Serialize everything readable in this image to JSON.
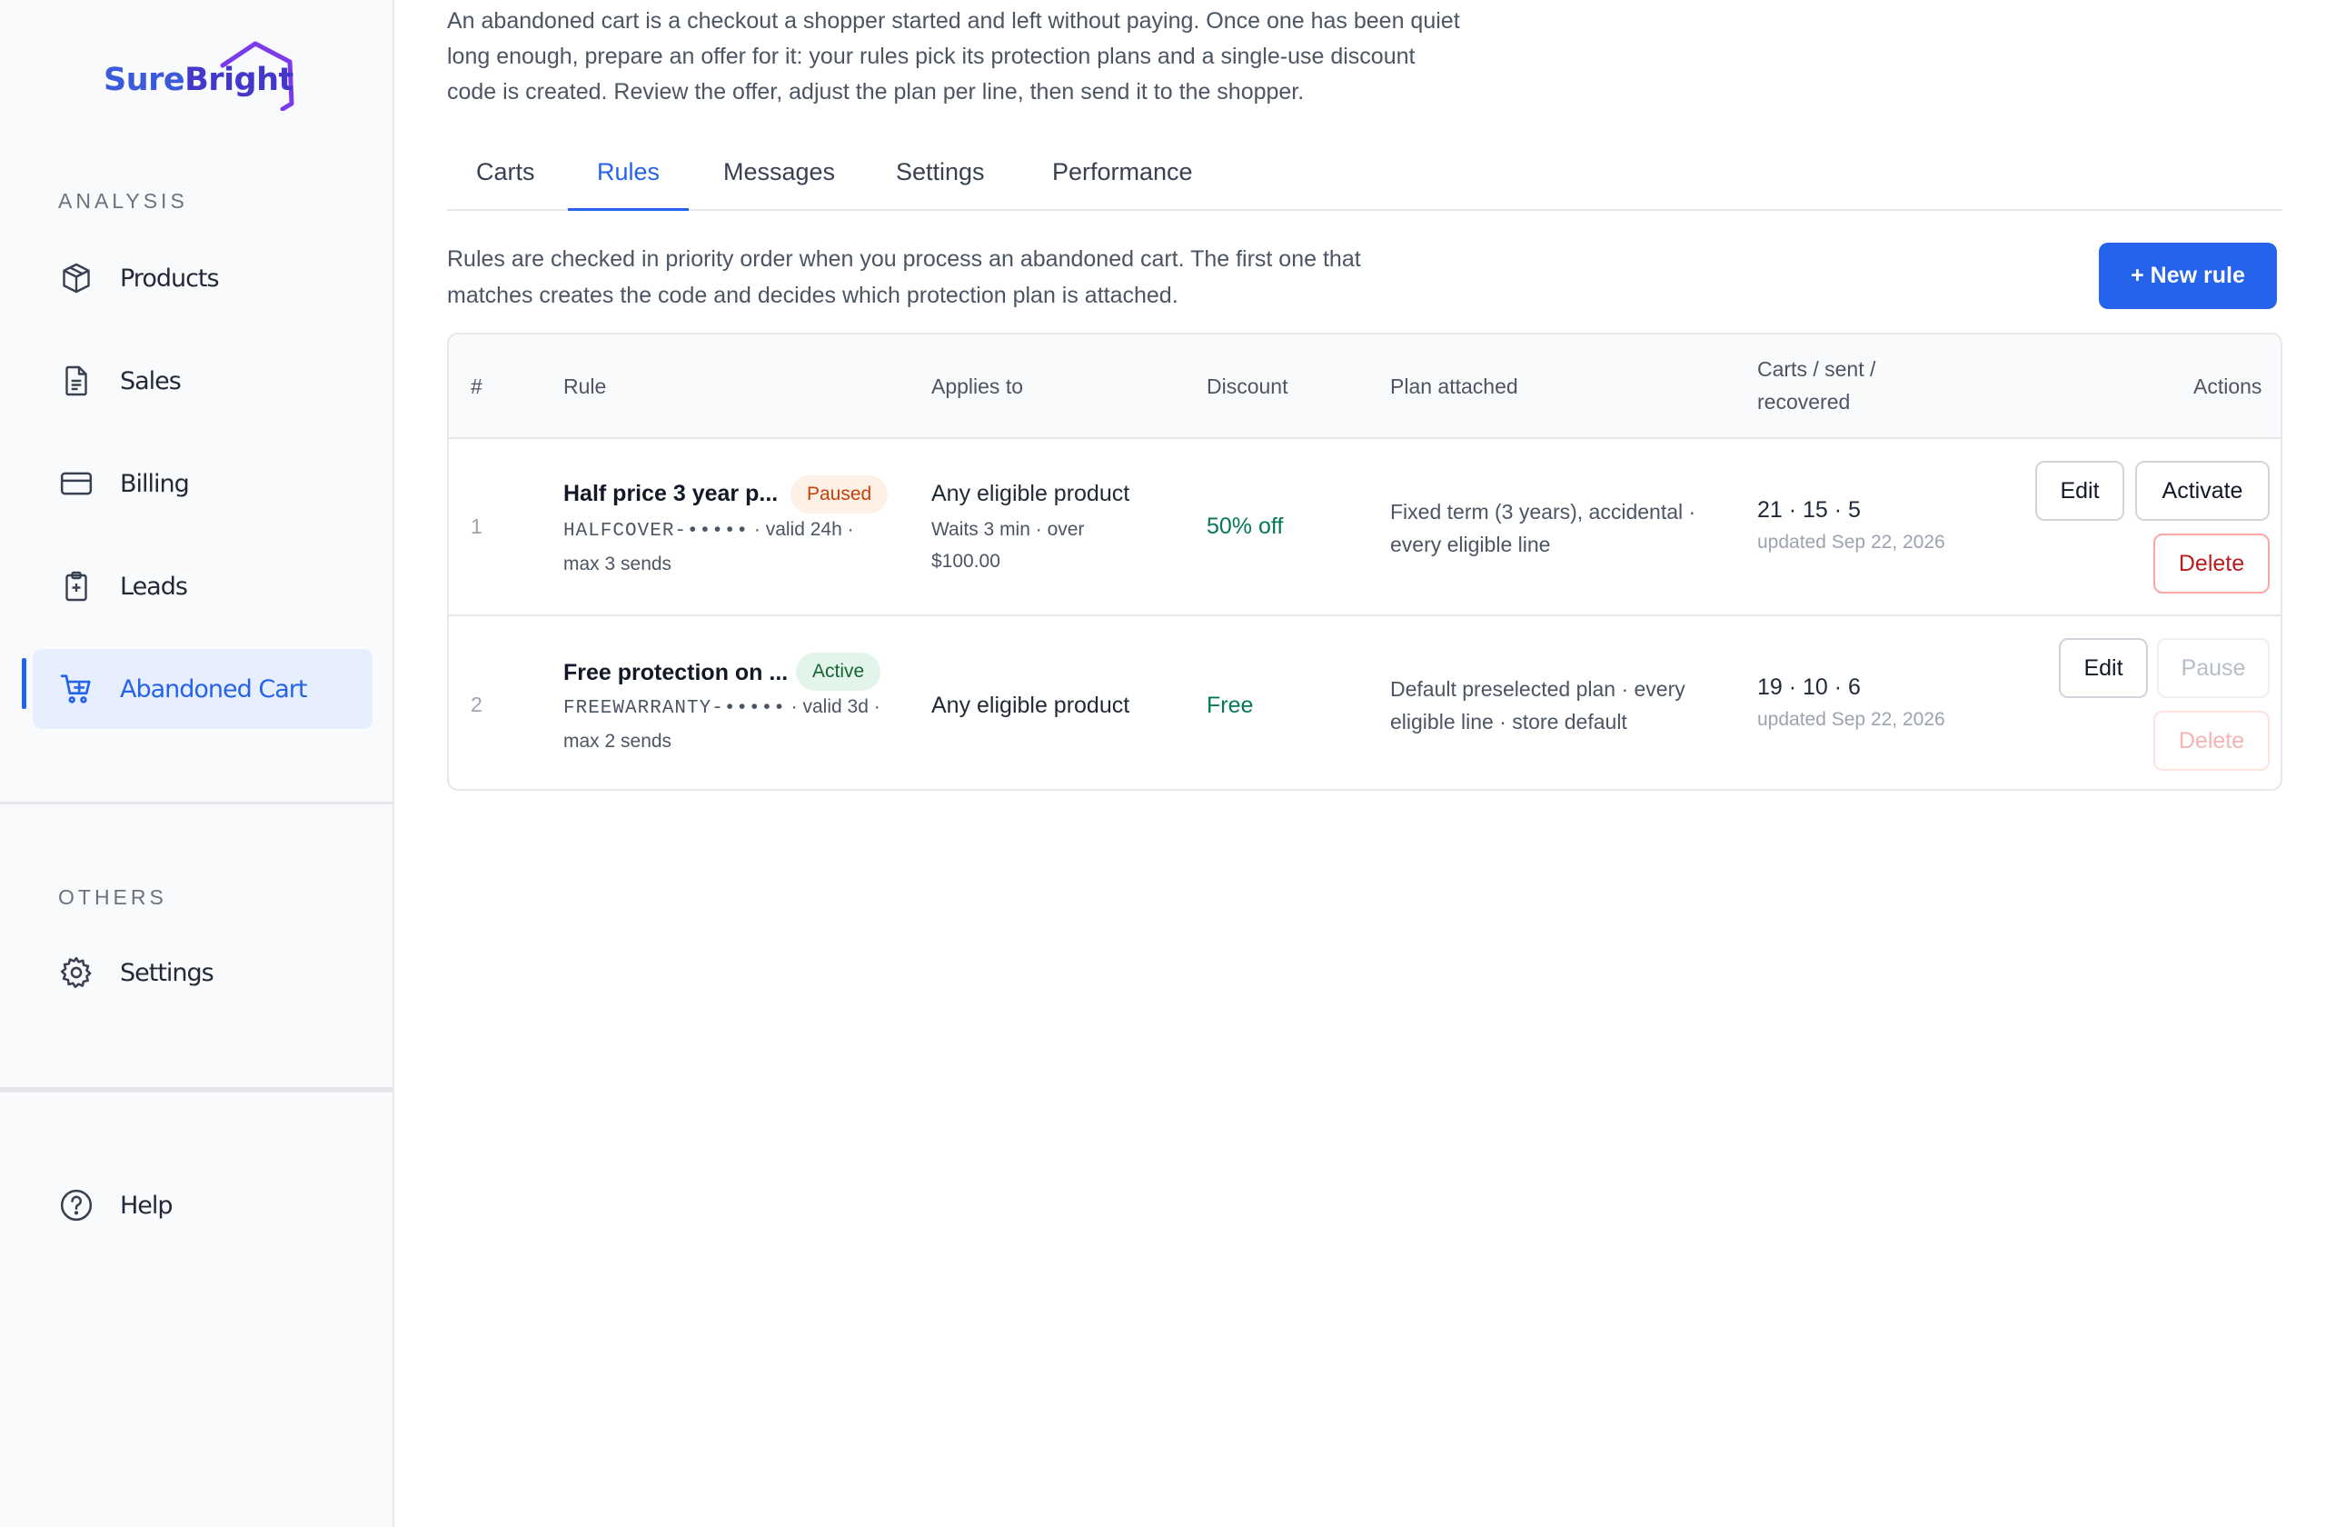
{
  "brand": {
    "name_part1": "Sure",
    "name_part2": "Bright"
  },
  "sidebar": {
    "analysis_label": "ANALYSIS",
    "others_label": "OTHERS",
    "items": [
      {
        "label": "Products",
        "icon": "package-icon"
      },
      {
        "label": "Sales",
        "icon": "document-icon"
      },
      {
        "label": "Billing",
        "icon": "credit-card-icon"
      },
      {
        "label": "Leads",
        "icon": "clipboard-plus-icon"
      },
      {
        "label": "Abandoned Cart",
        "icon": "cart-icon",
        "active": true
      }
    ],
    "others": [
      {
        "label": "Settings",
        "icon": "gear-icon"
      }
    ],
    "help": {
      "label": "Help",
      "icon": "question-icon"
    }
  },
  "intro": "An abandoned cart is a checkout a shopper started and left without paying. Once one has been quiet long enough, prepare an offer for it: your rules pick its protection plans and a single-use discount code is created. Review the offer, adjust the plan per line, then send it to the shopper.",
  "tabs": [
    {
      "label": "Carts"
    },
    {
      "label": "Rules",
      "active": true
    },
    {
      "label": "Messages"
    },
    {
      "label": "Settings"
    },
    {
      "label": "Performance"
    }
  ],
  "rules_description": "Rules are checked in priority order when you process an abandoned cart. The first one that matches creates the code and decides which protection plan is attached.",
  "new_rule_label": "+ New rule",
  "table": {
    "headers": {
      "index": "#",
      "rule": "Rule",
      "applies_to": "Applies to",
      "discount": "Discount",
      "plan": "Plan attached",
      "counts_line1": "Carts / sent /",
      "counts_line2": "recovered",
      "actions": "Actions"
    },
    "rows": [
      {
        "index": "1",
        "name": "Half price 3 year p...",
        "status": "Paused",
        "code": "HALFCOVER-•••••",
        "code_suffix": " · valid 24h ·",
        "sends": "max 3 sends",
        "applies_to": "Any eligible product",
        "applies_sub1": "Waits 3 min · over",
        "applies_sub2": "$100.00",
        "discount": "50% off",
        "plan": "Fixed term (3 years), accidental · every eligible line",
        "counts": "21 · 15 · 5",
        "updated": "updated Sep 22, 2026",
        "actions": {
          "edit": "Edit",
          "toggle": "Activate",
          "delete": "Delete"
        }
      },
      {
        "index": "2",
        "name": "Free protection on ...",
        "status": "Active",
        "code": "FREEWARRANTY-•••••",
        "code_suffix": " · valid 3d ·",
        "sends": "max 2 sends",
        "applies_to": "Any eligible product",
        "discount": "Free",
        "plan": "Default preselected plan · every eligible line · store default",
        "counts": "19 · 10 · 6",
        "updated": "updated Sep 22, 2026",
        "actions": {
          "edit": "Edit",
          "toggle": "Pause",
          "delete": "Delete"
        }
      }
    ]
  },
  "colors": {
    "accent": "#2563eb",
    "discount": "#047857",
    "danger": "#b91c1c",
    "paused_badge": "#fef0e4",
    "active_badge": "#e3f5ea"
  }
}
